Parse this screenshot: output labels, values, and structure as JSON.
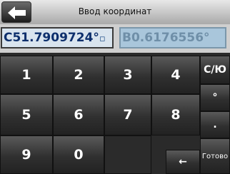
{
  "header": {
    "title": "Ввод координат",
    "back_icon": "arrow-left-icon"
  },
  "coordinates": {
    "latitude": "С51.7909724°",
    "longitude": "В0.6176556°"
  },
  "keypad": {
    "keys": [
      "1",
      "2",
      "3",
      "4",
      "5",
      "6",
      "7",
      "8",
      "9",
      "0"
    ],
    "hemisphere_label": "С/Ю",
    "degree_label": "°",
    "decimal_label": ".",
    "backspace_label": "←",
    "done_label": "Готово"
  },
  "colors": {
    "title_bar": "#c8c8c8",
    "lat_field": "#d9e4ee",
    "lon_field": "#a9c6db",
    "key_bg": "#3a3a3a"
  }
}
